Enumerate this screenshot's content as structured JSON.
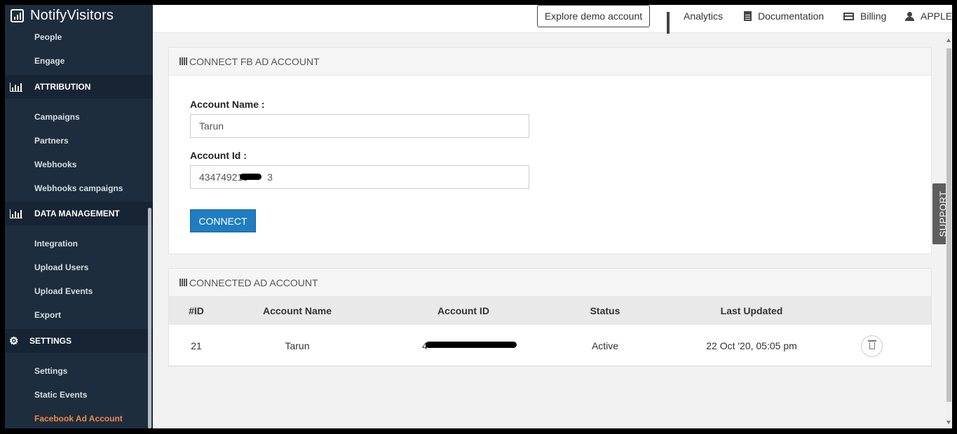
{
  "brand": {
    "name": "NotifyVisitors"
  },
  "sidebar": {
    "items_top": [
      "People",
      "Engage"
    ],
    "attribution": {
      "title": "ATTRIBUTION",
      "items": [
        "Campaigns",
        "Partners",
        "Webhooks",
        "Webhooks campaigns"
      ]
    },
    "data_management": {
      "title": "DATA MANAGEMENT",
      "items": [
        "Integration",
        "Upload Users",
        "Upload Events",
        "Export"
      ]
    },
    "settings": {
      "title": "SETTINGS",
      "items": [
        "Settings",
        "Static Events",
        "Facebook Ad Account"
      ],
      "active_item": "Facebook Ad Account"
    }
  },
  "topbar": {
    "demo_label": "Explore demo account",
    "analytics_label": "Analytics",
    "documentation_label": "Documentation",
    "billing_label": "Billing",
    "user_label": "APPLE"
  },
  "support_label": "SUPPORT",
  "connect_panel": {
    "title": "CONNECT FB AD ACCOUNT",
    "account_name_label": "Account Name :",
    "account_name_value": "Tarun",
    "account_id_label": "Account Id :",
    "account_id_value": "434749213",
    "account_id_suffix": "3",
    "connect_label": "CONNECT"
  },
  "connected_panel": {
    "title": "CONNECTED AD ACCOUNT",
    "columns": [
      "#ID",
      "Account Name",
      "Account ID",
      "Status",
      "Last Updated"
    ],
    "rows": [
      {
        "id": "21",
        "account_name": "Tarun",
        "account_id_visible": "4",
        "status": "Active",
        "last_updated": "22 Oct '20, 05:05 pm"
      }
    ]
  },
  "colors": {
    "sidebar_bg": "#1e2d3d",
    "active_item": "#f0874a",
    "primary_button": "#1f7dc2"
  }
}
